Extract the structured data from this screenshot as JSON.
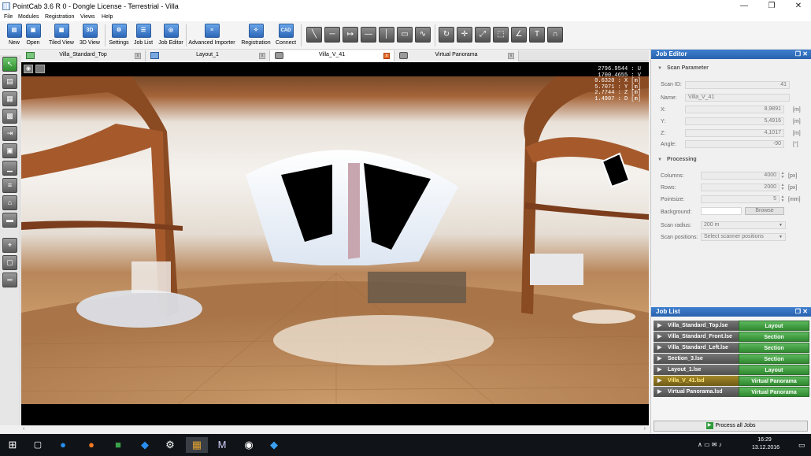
{
  "window": {
    "title": "PointCab 3.6 R 0 - Dongle License - Terrestrial - Villa"
  },
  "menu": [
    "File",
    "Modules",
    "Registration",
    "Views",
    "Help"
  ],
  "toolbar": [
    {
      "label": "New",
      "icon": "new-icon"
    },
    {
      "label": "Open",
      "icon": "open-icon"
    },
    {
      "label": "Tiled View",
      "icon": "tiled-view-icon"
    },
    {
      "label": "3D View",
      "icon": "3d-view-icon",
      "glyph": "3D"
    },
    {
      "label": "Settings",
      "icon": "settings-icon"
    },
    {
      "label": "Job List",
      "icon": "job-list-icon"
    },
    {
      "label": "Job Editor",
      "icon": "job-editor-icon"
    },
    {
      "label": "Advanced Importer",
      "icon": "advanced-importer-icon"
    },
    {
      "label": "Registration",
      "icon": "registration-icon"
    },
    {
      "label": "Connect",
      "icon": "cad-connect-icon",
      "glyph": "CAD"
    }
  ],
  "tabs": [
    {
      "label": "Villa_Standard_Top",
      "icon": "layout-view-icon"
    },
    {
      "label": "Layout_1",
      "icon": "layout-icon"
    },
    {
      "label": "Villa_V_41",
      "icon": "panorama-icon",
      "active": true
    },
    {
      "label": "Virtual Panorama",
      "icon": "panorama-icon"
    }
  ],
  "viewport": {
    "coords": [
      "2796.9544 : U",
      "1700.4655 : V",
      "0.6320 : X [m]",
      "5.7071 : Y [m]",
      "2.7744 : Z [m]",
      "1.4907 : D [m]"
    ]
  },
  "job_editor": {
    "title": "Job Editor",
    "scan_parameter": {
      "heading": "Scan Parameter",
      "scan_id_label": "Scan ID:",
      "scan_id": "41",
      "name_label": "Name:",
      "name": "Villa_V_41",
      "x_label": "X:",
      "x": "8,9891",
      "x_unit": "[m]",
      "y_label": "Y:",
      "y": "5,4916",
      "y_unit": "[m]",
      "z_label": "Z:",
      "z": "4,1017",
      "z_unit": "[m]",
      "angle_label": "Angle:",
      "angle": "-90",
      "angle_unit": "[°]"
    },
    "processing": {
      "heading": "Processing",
      "columns_label": "Columns:",
      "columns": "4000",
      "columns_unit": "[px]",
      "rows_label": "Rows:",
      "rows": "2000",
      "rows_unit": "[px]",
      "pointsize_label": "Pointsize:",
      "pointsize": "5",
      "pointsize_unit": "[mm]",
      "background_label": "Background:",
      "browse": "Browse",
      "scan_radius_label": "Scan radius:",
      "scan_radius": "200 m",
      "scan_positions_label": "Scan positions:",
      "scan_positions": "Select scanner positions"
    }
  },
  "job_list": {
    "title": "Job List",
    "jobs": [
      {
        "name": "Villa_Standard_Top.lse",
        "type": "Layout"
      },
      {
        "name": "Villa_Standard_Front.lse",
        "type": "Section"
      },
      {
        "name": "Villa_Standard_Left.lse",
        "type": "Section"
      },
      {
        "name": "Section_3.lse",
        "type": "Section"
      },
      {
        "name": "Layout_1.lse",
        "type": "Layout"
      },
      {
        "name": "Villa_V_41.lsd",
        "type": "Virtual Panorama",
        "selected": true
      },
      {
        "name": "Virtual Panorama.lsd",
        "type": "Virtual Panorama"
      }
    ],
    "process_all": "Process all Jobs"
  },
  "taskbar": {
    "time": "16:29",
    "date": "13.12.2016"
  }
}
